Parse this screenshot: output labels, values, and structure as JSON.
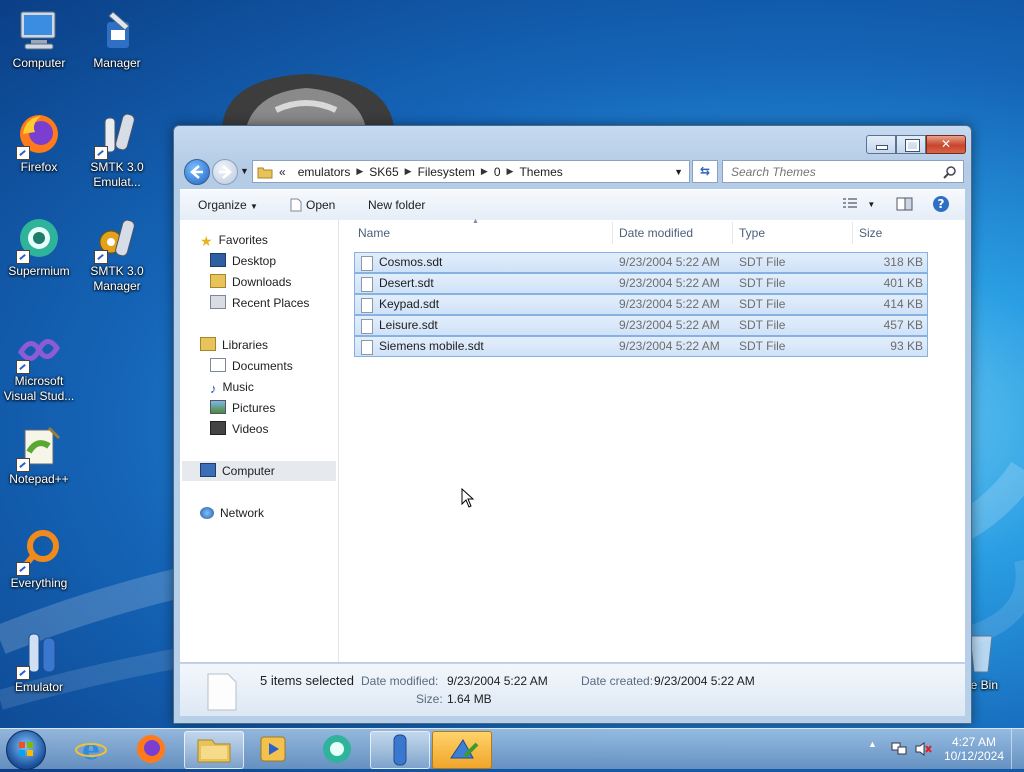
{
  "desktop": {
    "icons": [
      {
        "label": "Computer",
        "icon": "computer-icon"
      },
      {
        "label": "Manager",
        "icon": "manager-icon"
      },
      {
        "label": "Firefox",
        "icon": "firefox-icon"
      },
      {
        "label": "SMTK 3.0 Emulat...",
        "icon": "smtk-emulator-icon"
      },
      {
        "label": "Supermium",
        "icon": "supermium-icon"
      },
      {
        "label": "SMTK 3.0 Manager",
        "icon": "smtk-manager-icon"
      },
      {
        "label": "Microsoft Visual Stud...",
        "icon": "visual-studio-icon"
      },
      {
        "label": "Notepad++",
        "icon": "notepadpp-icon"
      },
      {
        "label": "Everything",
        "icon": "everything-icon"
      },
      {
        "label": "Emulator",
        "icon": "emulator-icon"
      },
      {
        "label": "cle Bin",
        "icon": "recycle-bin-icon"
      }
    ]
  },
  "window": {
    "address": {
      "prefix": "«",
      "crumbs": [
        "emulators",
        "SK65",
        "Filesystem",
        "0",
        "Themes"
      ]
    },
    "search_placeholder": "Search Themes",
    "toolbar": {
      "organize": "Organize",
      "open": "Open",
      "new_folder": "New folder"
    },
    "nav": {
      "favorites": "Favorites",
      "desktop": "Desktop",
      "downloads": "Downloads",
      "recent": "Recent Places",
      "libraries": "Libraries",
      "documents": "Documents",
      "music": "Music",
      "pictures": "Pictures",
      "videos": "Videos",
      "computer": "Computer",
      "network": "Network"
    },
    "columns": {
      "name": "Name",
      "date": "Date modified",
      "type": "Type",
      "size": "Size"
    },
    "files": [
      {
        "name": "Cosmos.sdt",
        "date": "9/23/2004 5:22 AM",
        "type": "SDT File",
        "size": "318 KB"
      },
      {
        "name": "Desert.sdt",
        "date": "9/23/2004 5:22 AM",
        "type": "SDT File",
        "size": "401 KB"
      },
      {
        "name": "Keypad.sdt",
        "date": "9/23/2004 5:22 AM",
        "type": "SDT File",
        "size": "414 KB"
      },
      {
        "name": "Leisure.sdt",
        "date": "9/23/2004 5:22 AM",
        "type": "SDT File",
        "size": "457 KB"
      },
      {
        "name": "Siemens mobile.sdt",
        "date": "9/23/2004 5:22 AM",
        "type": "SDT File",
        "size": "93 KB"
      }
    ],
    "details": {
      "selected": "5 items selected",
      "date_modified_label": "Date modified:",
      "date_modified": "9/23/2004 5:22 AM",
      "date_created_label": "Date created:",
      "date_created": "9/23/2004 5:22 AM",
      "size_label": "Size:",
      "size": "1.64 MB"
    }
  },
  "taskbar": {
    "clock_time": "4:27 AM",
    "clock_date": "10/12/2024"
  },
  "colors": {
    "selection": "#cfe2f8",
    "selection_border": "#86b2e3",
    "close_button": "#c8442b"
  }
}
